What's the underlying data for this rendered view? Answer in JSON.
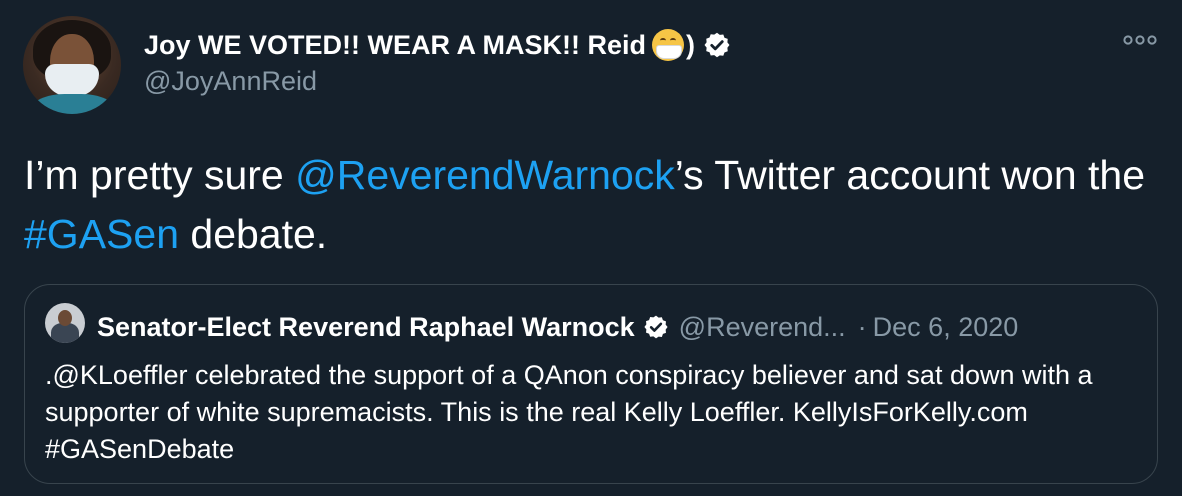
{
  "author": {
    "display_name": "Joy WE VOTED!! WEAR A MASK!! Reid",
    "name_emoji": "face-with-medical-mask-emoji",
    "name_suffix": ")",
    "handle": "@JoyAnnReid",
    "verified": true
  },
  "tweet": {
    "text_1": "I’m pretty sure ",
    "mention": "@ReverendWarnock",
    "text_2": "’s Twitter account won the ",
    "hashtag": "#GASen",
    "text_3": " debate."
  },
  "quoted_tweet": {
    "display_name": "Senator-Elect Reverend Raphael Warnock",
    "verified": true,
    "handle": "@Reverend...",
    "separator": "·",
    "date": "Dec 6, 2020",
    "text": ".@KLoeffler celebrated the support of a QAnon conspiracy believer and sat down with a supporter of white supremacists. This is the real Kelly Loeffler. KellyIsForKelly.com #GASenDebate"
  },
  "colors": {
    "background": "#15202b",
    "link": "#1da1f2",
    "secondary_text": "#8899a6",
    "border": "#38444d"
  },
  "icons": [
    "verified-badge-icon",
    "more-options-icon"
  ]
}
